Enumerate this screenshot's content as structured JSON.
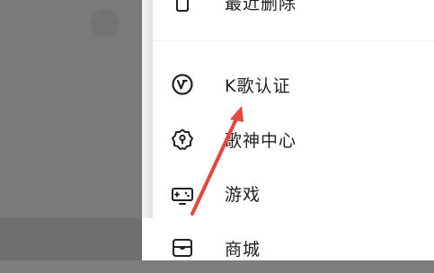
{
  "drawer": {
    "items": [
      {
        "label": "最近删除",
        "icon": "trash-icon"
      },
      {
        "label": "K歌认证",
        "icon": "verified-v-icon"
      },
      {
        "label": "歌神中心",
        "icon": "badge-gear-icon"
      },
      {
        "label": "游戏",
        "icon": "gamepad-icon"
      },
      {
        "label": "商城",
        "icon": "shop-icon"
      }
    ]
  },
  "colors": {
    "overlay": "#7b7b7b",
    "drawer_bg": "#ffffff",
    "text": "#1f1f1f",
    "annotation_arrow": "#e8453c"
  }
}
